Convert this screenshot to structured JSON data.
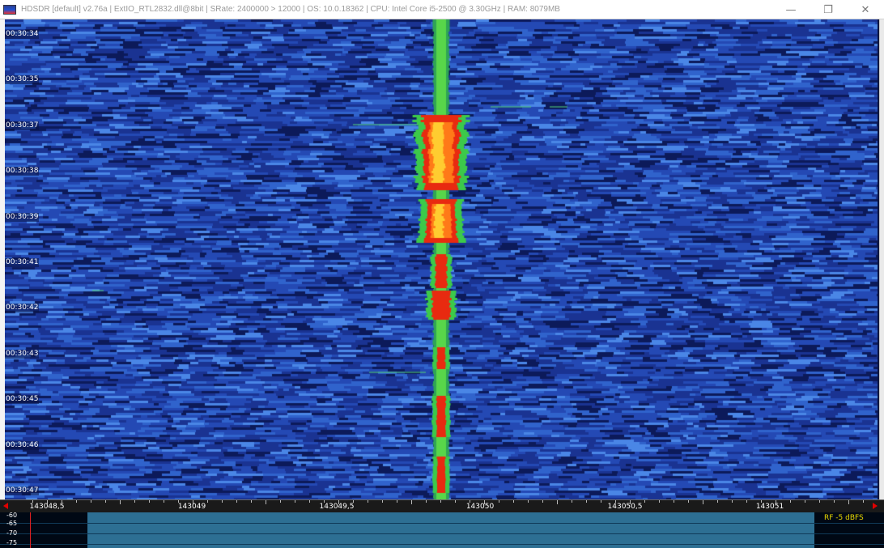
{
  "window": {
    "title": "HDSDR  [default]  v2.76a  |  ExtIO_RTL2832.dll@8bit  |  SRate: 2400000 > 12000  |  OS: 10.0.18362    |  CPU: Intel Core i5-2500 @ 3.30GHz  |  RAM: 8079MB",
    "minimize_glyph": "—",
    "maximize_glyph": "❐",
    "close_glyph": "✕",
    "icon": "hdsdr-app-icon"
  },
  "waterfall": {
    "time_labels": [
      "00:30:34",
      "00:30:35",
      "00:30:37",
      "00:30:38",
      "00:30:39",
      "00:30:41",
      "00:30:42",
      "00:30:43",
      "00:30:45",
      "00:30:46",
      "00:30:47"
    ],
    "colors": {
      "background": "#182d85",
      "noise_light": "#3f7fe0",
      "signal_green": "#3cc94a",
      "signal_red": "#e82a10",
      "signal_yellow": "#ffcc30"
    }
  },
  "frequency_axis": {
    "labels": [
      "143048,5",
      "143049",
      "143049,5",
      "143050",
      "143050,5",
      "143051"
    ]
  },
  "spectrum": {
    "db_labels": [
      "-60",
      "-65",
      "-70",
      "-75"
    ],
    "rf_level": "RF  -5 dBFS"
  }
}
